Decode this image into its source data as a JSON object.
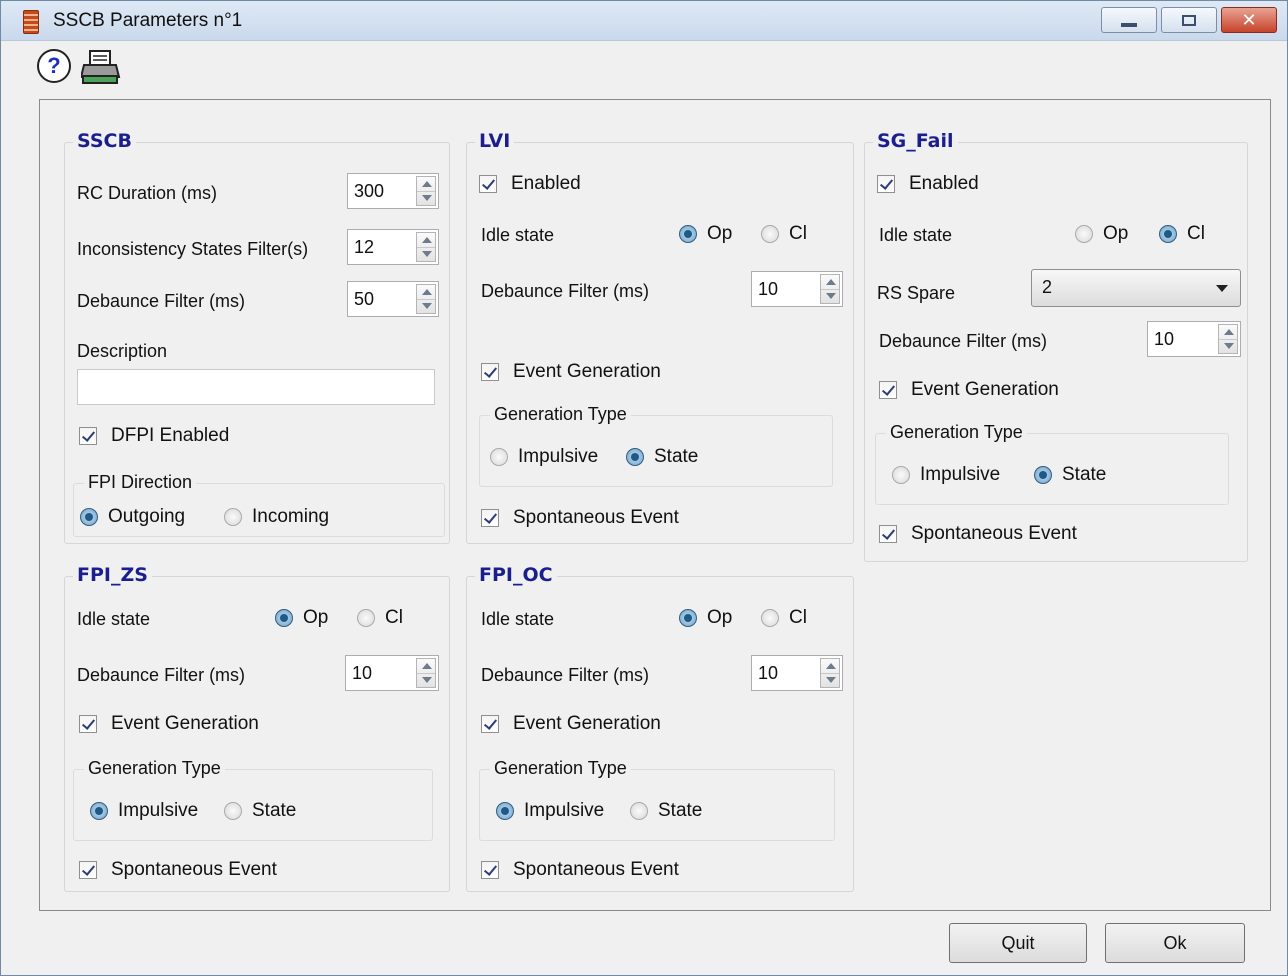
{
  "window": {
    "title": "SSCB Parameters n°1",
    "close_glyph": "✕"
  },
  "toolbar": {
    "help_glyph": "?",
    "help_icon": "help-icon",
    "print_icon": "printer-icon"
  },
  "sscb": {
    "title": "SSCB",
    "rc_duration_label": "RC Duration (ms)",
    "rc_duration_value": "300",
    "inconsistency_label": "Inconsistency States Filter(s)",
    "inconsistency_value": "12",
    "debounce_label": "Debaunce Filter (ms)",
    "debounce_value": "50",
    "description_label": "Description",
    "description_value": "",
    "dfpi_label": "DFPI Enabled",
    "fpi_direction_title": "FPI Direction",
    "outgoing_label": "Outgoing",
    "incoming_label": "Incoming"
  },
  "lvi": {
    "title": "LVI",
    "enabled_label": "Enabled",
    "idle_label": "Idle state",
    "op_label": "Op",
    "cl_label": "Cl",
    "debounce_label": "Debaunce Filter (ms)",
    "debounce_value": "10",
    "event_gen_label": "Event Generation",
    "gen_type_title": "Generation Type",
    "impulsive_label": "Impulsive",
    "state_label": "State",
    "spontaneous_label": "Spontaneous Event"
  },
  "sg_fail": {
    "title": "SG_Fail",
    "enabled_label": "Enabled",
    "idle_label": "Idle state",
    "op_label": "Op",
    "cl_label": "Cl",
    "rs_spare_label": "RS Spare",
    "rs_spare_value": "2",
    "debounce_label": "Debaunce Filter (ms)",
    "debounce_value": "10",
    "event_gen_label": "Event Generation",
    "gen_type_title": "Generation Type",
    "impulsive_label": "Impulsive",
    "state_label": "State",
    "spontaneous_label": "Spontaneous Event"
  },
  "fpi_zs": {
    "title": "FPI_ZS",
    "idle_label": "Idle state",
    "op_label": "Op",
    "cl_label": "Cl",
    "debounce_label": "Debaunce Filter (ms)",
    "debounce_value": "10",
    "event_gen_label": "Event Generation",
    "gen_type_title": "Generation Type",
    "impulsive_label": "Impulsive",
    "state_label": "State",
    "spontaneous_label": "Spontaneous Event"
  },
  "fpi_oc": {
    "title": "FPI_OC",
    "idle_label": "Idle state",
    "op_label": "Op",
    "cl_label": "Cl",
    "debounce_label": "Debaunce Filter (ms)",
    "debounce_value": "10",
    "event_gen_label": "Event Generation",
    "gen_type_title": "Generation Type",
    "impulsive_label": "Impulsive",
    "state_label": "State",
    "spontaneous_label": "Spontaneous Event"
  },
  "footer": {
    "quit_label": "Quit",
    "ok_label": "Ok"
  }
}
